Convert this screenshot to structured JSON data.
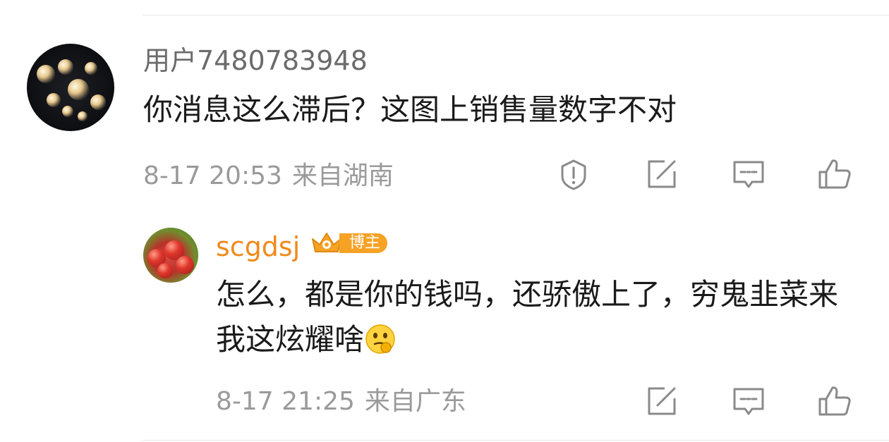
{
  "comment": {
    "username": "用户7480783948",
    "text": "你消息这么滞后？这图上销售量数字不对",
    "time": "8-17 20:53",
    "location": "来自湖南",
    "actions": {
      "report_icon": "exclamation-shield-icon",
      "share_icon": "share-edit-icon",
      "reply_icon": "comment-icon",
      "like_icon": "thumbs-up-icon"
    }
  },
  "reply": {
    "username": "scgdsj",
    "badge": "博主",
    "text": "怎么，都是你的钱吗，还骄傲上了，穷鬼韭菜来我这炫耀啥",
    "emoji": "thinking-face-emoji",
    "time": "8-17 21:25",
    "location": "来自广东",
    "actions": {
      "share_icon": "share-edit-icon",
      "reply_icon": "comment-icon",
      "like_icon": "thumbs-up-icon"
    }
  },
  "colors": {
    "username": "#6b6b6b",
    "author_name": "#f08a1c",
    "badge_bg": "#f5a225",
    "meta_text": "#9a9a9a",
    "body_text": "#1a1a1a",
    "icon": "#8a8a8a"
  }
}
